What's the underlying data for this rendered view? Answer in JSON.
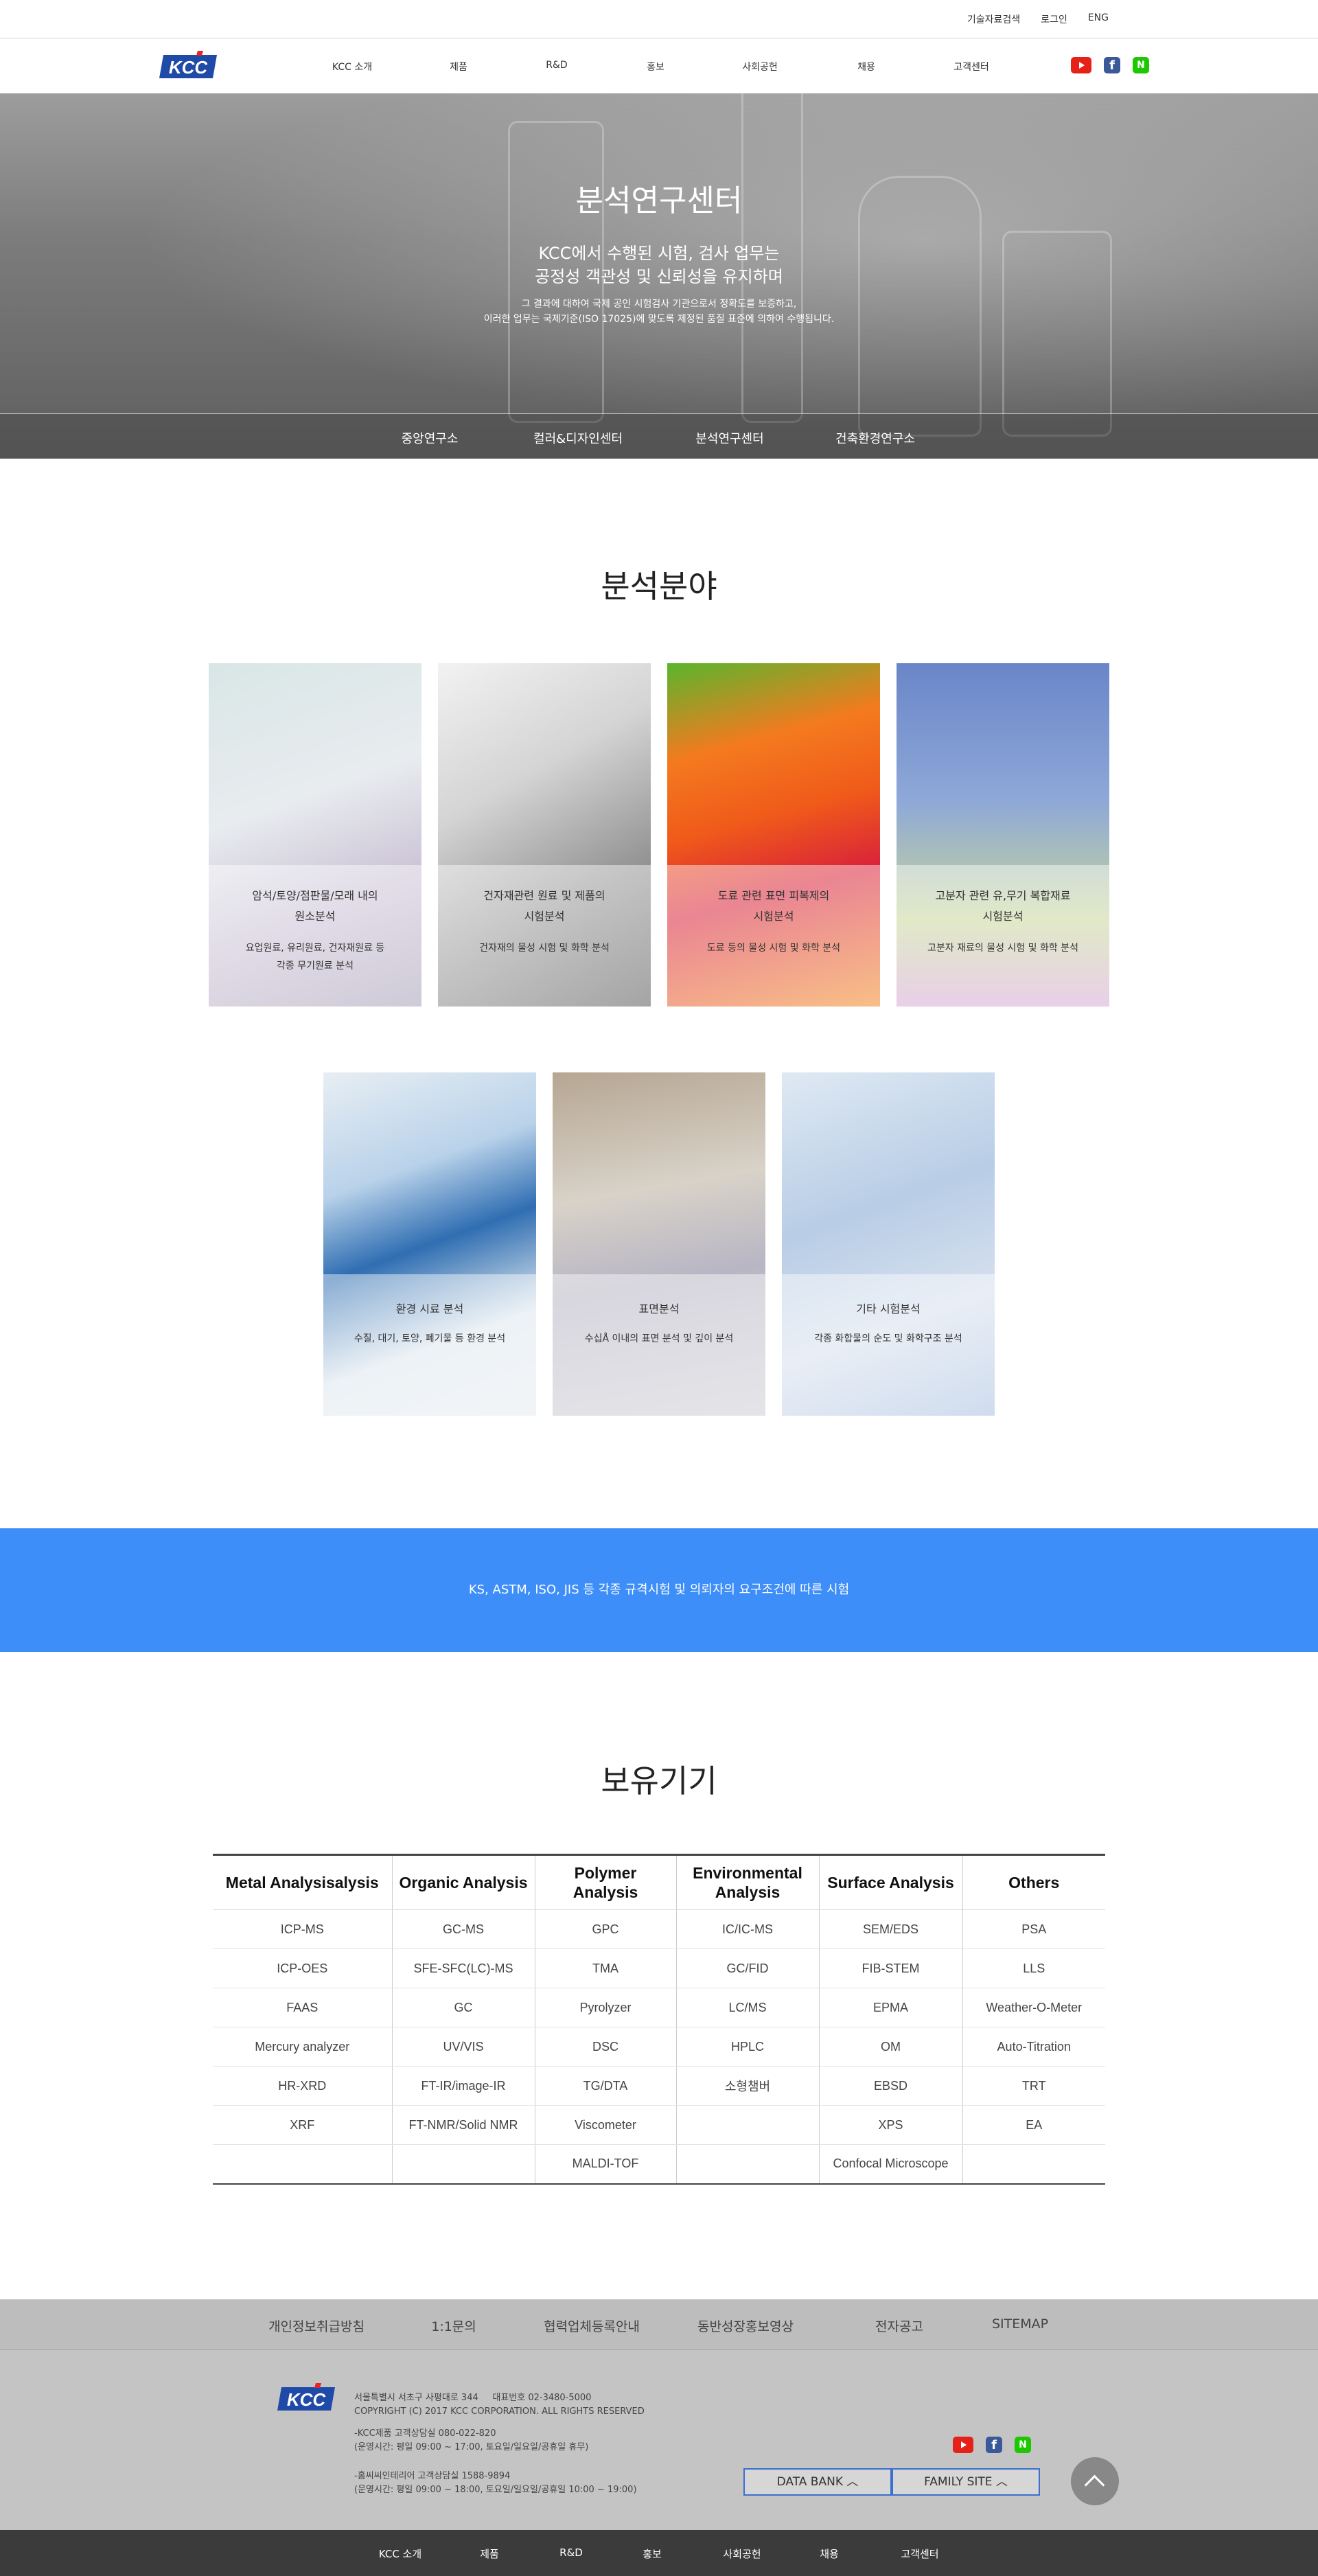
{
  "util": {
    "links": [
      "기술자료검색",
      "로그인",
      "ENG"
    ]
  },
  "header": {
    "logo_text": "KCC",
    "nav": [
      "KCC 소개",
      "제품",
      "R&D",
      "홍보",
      "사회공헌",
      "채용",
      "고객센터"
    ],
    "social": [
      "youtube-icon",
      "facebook-icon",
      "naver-icon"
    ]
  },
  "hero": {
    "title": "분석연구센터",
    "subtitle_line1": "KCC에서 수행된 시험, 검사 업무는",
    "subtitle_line2": "공정성 객관성 및 신뢰성을 유지하며",
    "desc_line1": "그 결과에 대하여 국제 공인 시험검사 기관으로서 정확도를 보증하고,",
    "desc_line2": "이러한 업무는 국제기준(ISO 17025)에 맞도록 제정된 품질 표준에 의하여 수행됩니다.",
    "tabs": [
      "중앙연구소",
      "컬러&디자인센터",
      "분석연구센터",
      "건축환경연구소"
    ]
  },
  "analysis": {
    "title": "분석분야",
    "cards": [
      {
        "title1": "암석/토양/점판물/모래 내의",
        "title2": "원소분석",
        "desc1": "요업원료, 유리원료, 건자재원료 등",
        "desc2": "각종 무기원료 분석"
      },
      {
        "title1": "건자재관련 원료 및 제품의",
        "title2": "시험분석",
        "desc1": "건자재의 물성 시험 및 화학 분석",
        "desc2": ""
      },
      {
        "title1": "도료 관련 표면 피복제의",
        "title2": "시험분석",
        "desc1": "도료 등의 물성 시험 및 화학 분석",
        "desc2": ""
      },
      {
        "title1": "고분자 관련 유,무기 복합재료",
        "title2": "시험분석",
        "desc1": "고분자 재료의 물성 시험 및 화학 분석",
        "desc2": ""
      },
      {
        "title1": "환경 시료 분석",
        "title2": "",
        "desc1": "수질, 대기, 토양, 폐기물 등 환경 분석",
        "desc2": ""
      },
      {
        "title1": "표면분석",
        "title2": "",
        "desc1": "수십Å 이내의 표면 분석 및 깊이 분석",
        "desc2": ""
      },
      {
        "title1": "기타 시험분석",
        "title2": "",
        "desc1": "각종 화합물의 순도 및 화학구조 분석",
        "desc2": ""
      }
    ]
  },
  "banner": {
    "text": "KS, ASTM, ISO, JIS 등 각종 규격시험 및 의뢰자의 요구조건에 따른 시험"
  },
  "equipment": {
    "title": "보유기기",
    "headers": [
      "Metal Analysisalysis",
      "Organic Analysis",
      "Polymer Analysis",
      "Environmental Analysis",
      "Surface Analysis",
      "Others"
    ],
    "rows": [
      [
        "ICP-MS",
        "GC-MS",
        "GPC",
        "IC/IC-MS",
        "SEM/EDS",
        "PSA"
      ],
      [
        "ICP-OES",
        "SFE-SFC(LC)-MS",
        "TMA",
        "GC/FID",
        "FIB-STEM",
        "LLS"
      ],
      [
        "FAAS",
        "GC",
        "Pyrolyzer",
        "LC/MS",
        "EPMA",
        "Weather-O-Meter"
      ],
      [
        "Mercury analyzer",
        "UV/VIS",
        "DSC",
        "HPLC",
        "OM",
        "Auto-Titration"
      ],
      [
        "HR-XRD",
        "FT-IR/image-IR",
        "TG/DTA",
        "소형챔버",
        "EBSD",
        "TRT"
      ],
      [
        "XRF",
        "FT-NMR/Solid NMR",
        "Viscometer",
        "",
        "XPS",
        "EA"
      ],
      [
        "",
        "",
        "MALDI-TOF",
        "",
        "Confocal Microscope",
        ""
      ]
    ]
  },
  "footer": {
    "links": [
      "개인정보취급방침",
      "1:1문의",
      "협력업체등록안내",
      "동반성장홍보영상",
      "전자공고",
      "SITEMAP"
    ],
    "address": "서울특별시 서초구 사평대로 344     대표번호 02-3480-5000",
    "copyright": "COPYRIGHT (C) 2017 KCC CORPORATION. ALL RIGHTS RESERVED",
    "cs1_line1": "-KCC제품 고객상담실 080-022-820",
    "cs1_line2": "(운영시간: 평일 09:00 ~ 17:00, 토요일/일요일/공휴일 휴무)",
    "cs2_line1": "-홈씨씨인테리어 고객상담실 1588-9894",
    "cs2_line2": "(운영시간: 평일 09:00 ~ 18:00, 토요일/일요일/공휴일 10:00 ~ 19:00)",
    "data_bank": "DATA BANK  ︿",
    "family_site": "FAMILY SITE  ︿",
    "bottom_nav": [
      "KCC 소개",
      "제품",
      "R&D",
      "홍보",
      "사회공헌",
      "채용",
      "고객센터"
    ]
  }
}
